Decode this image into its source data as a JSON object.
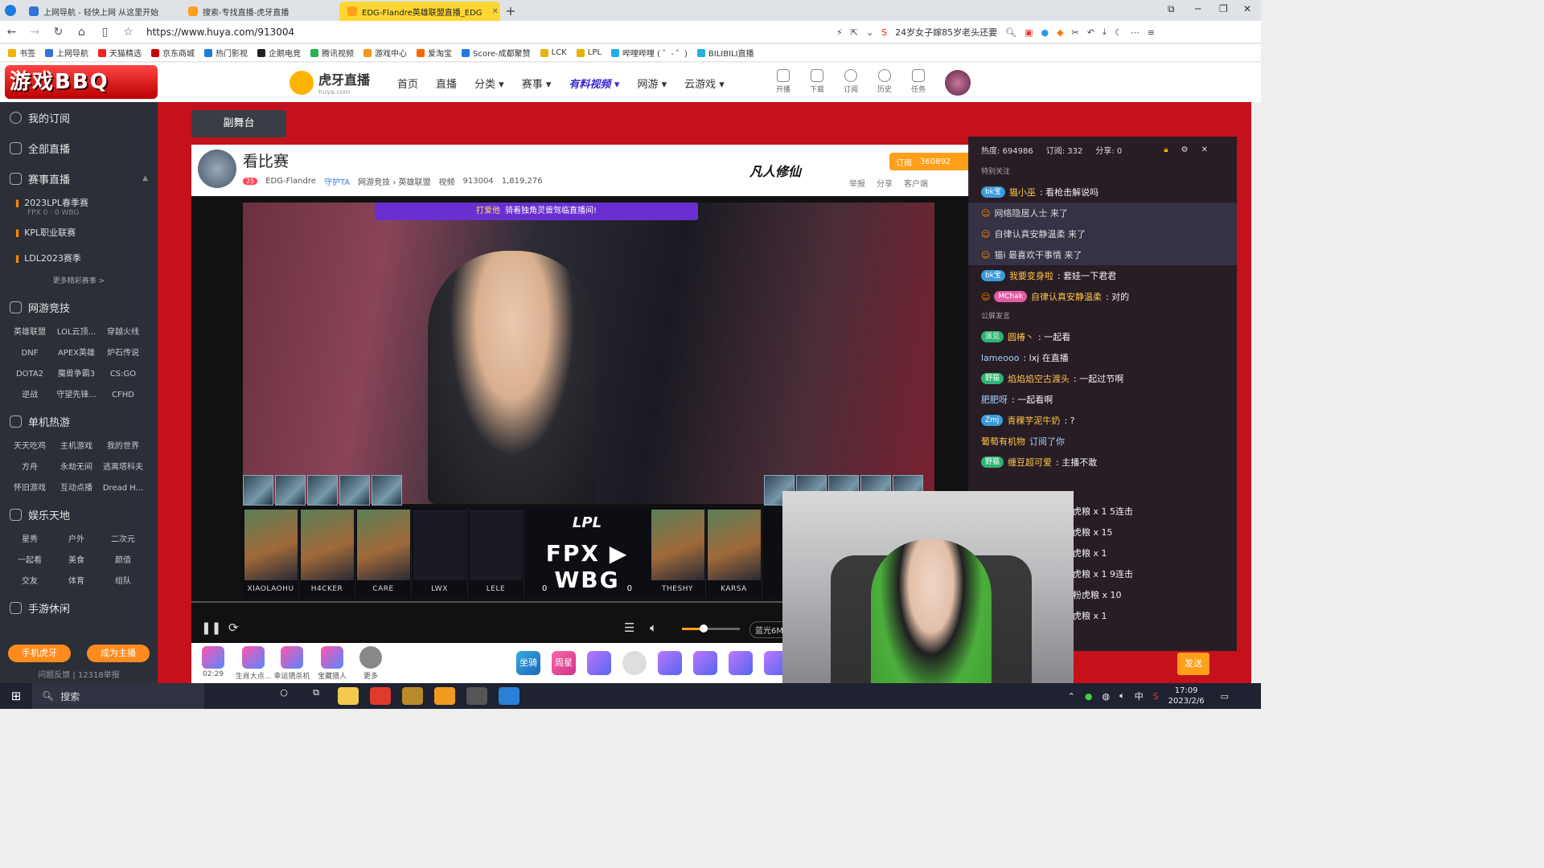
{
  "browser": {
    "tabs": [
      {
        "title": "上网导航 - 轻快上网 从这里开始",
        "color": "#2f74d6",
        "active": false
      },
      {
        "title": "搜索-专找直播-虎牙直播",
        "color": "#ff9f1a",
        "active": false
      },
      {
        "title": "EDG-Flandre英雄联盟直播_EDG",
        "color": "#ff9f1a",
        "active": true
      }
    ],
    "new_tab": "+",
    "url": "https://www.huya.com/913004",
    "search_hint": "24岁女子嫁85岁老头还要",
    "bookmarks": [
      "书签",
      "上网导航",
      "天猫精选",
      "京东商城",
      "热门影视",
      "企鹅电竞",
      "腾讯视频",
      "游戏中心",
      "爱淘宝",
      "Score-成都聚赞",
      "LCK",
      "LPL",
      "哔哩哔哩 ( ゜- ゜)",
      "BILIBILI直播"
    ]
  },
  "site": {
    "logo_text": "游戏BBQ",
    "huya_name": "虎牙直播",
    "huya_sub": "huya.com",
    "nav": [
      "首页",
      "直播",
      "分类 ▾",
      "赛事 ▾",
      "有料视频 ▾",
      "网游 ▾",
      "云游戏 ▾"
    ],
    "tools": [
      "开播",
      "下载",
      "订阅",
      "历史",
      "任务"
    ]
  },
  "sidebar": {
    "main": [
      "我的订阅",
      "全部直播",
      "赛事直播"
    ],
    "events": [
      {
        "title": "2023LPL春季赛",
        "score": "FPX 0 · 0 WBG"
      },
      {
        "title": "KPL职业联赛",
        "score": ""
      },
      {
        "title": "LDL2023赛季",
        "score": ""
      }
    ],
    "more": "更多精彩赛事 >",
    "sections": [
      {
        "name": "网游竞技",
        "items": [
          "英雄联盟",
          "LOL云顶...",
          "穿越火线",
          "DNF",
          "APEX英雄",
          "炉石传说",
          "DOTA2",
          "魔兽争霸3",
          "CS:GO",
          "逆战",
          "守望先锋...",
          "CFHD"
        ]
      },
      {
        "name": "单机热游",
        "items": [
          "天天吃鸡",
          "主机游戏",
          "我的世界",
          "方舟",
          "永劫无间",
          "逃离塔科夫",
          "怀旧游戏",
          "互动点播",
          "Dread H..."
        ]
      },
      {
        "name": "娱乐天地",
        "items": [
          "星秀",
          "户外",
          "二次元",
          "一起看",
          "美食",
          "颜值",
          "交友",
          "体育",
          "组队"
        ]
      },
      {
        "name": "手游休闲",
        "items": []
      }
    ],
    "btn_phone": "手机虎牙",
    "btn_anchor": "成为主播",
    "footer": "问题反馈 | 12318举报"
  },
  "room": {
    "stage": "副舞台",
    "title": "看比赛",
    "level": "25",
    "streamer": "EDG-Flandre",
    "guard": "守护TA",
    "category": "网游竞技 › 英雄联盟",
    "video": "视频",
    "room_id": "913004",
    "viewers": "1,819,276",
    "logo": "凡人修仙",
    "report": "举报",
    "share": "分享",
    "client": "客户端",
    "subscribe": "订阅",
    "subscribe_count": "360892"
  },
  "video": {
    "promo_highlight": "打爱他",
    "promo_text": "骑着独角灵兽驾临直播间!",
    "event": "LPL",
    "team1": "FPX",
    "team2": "WBG",
    "score1": "0",
    "score2": "0",
    "players_left": [
      "XIAOLAOHU",
      "H4CKER",
      "CARE",
      "LWX",
      "LELE"
    ],
    "players_right": [
      "THESHY",
      "KARSA"
    ],
    "volume": 0.38,
    "quality": "蓝光6M"
  },
  "gifts": {
    "time": "02:29",
    "items": [
      "生肖大点...",
      "幸运猎杀机",
      "宝藏猎人",
      "更多"
    ],
    "right": [
      "坐骑",
      "周星"
    ]
  },
  "chat": {
    "heat_label": "热度: 694986",
    "sub_label": "订阅: 332",
    "share_label": "分享: 0",
    "special": "特别关注",
    "public": "公屏发言",
    "special_msgs": [
      {
        "badge": "bk宝",
        "nick": "猫小巫",
        "text": ": 看枪击解说吗",
        "color": "#3a9bdc"
      },
      {
        "badge": "",
        "nick": "",
        "text": "网络隐居人士 来了",
        "color": ""
      },
      {
        "badge": "",
        "nick": "",
        "text": "自律认真安静温柔 来了",
        "color": ""
      },
      {
        "badge": "",
        "nick": "",
        "text": "猫i 最喜欢干事情 来了",
        "color": ""
      },
      {
        "badge": "bk宝",
        "nick": "我要变身啦",
        "text": ": 套娃一下君君",
        "color": "#3a9bdc"
      },
      {
        "badge": "MChak",
        "nick": "自律认真安静温柔",
        "text": ": 对的",
        "color": "#e05ca4"
      }
    ],
    "public_msgs": [
      {
        "badge": "派见",
        "nick": "圆椿丶",
        "text": ": 一起看",
        "color": "#2fb374"
      },
      {
        "badge": "",
        "nick": "lameooo",
        "text": ": lxj 在直播",
        "color": ""
      },
      {
        "badge": "野猫",
        "nick": "焰焰焰空古渡头",
        "text": ": 一起过节啊",
        "color": "#2fb374"
      },
      {
        "badge": "",
        "nick": "肥肥呀",
        "text": ": 一起看啊",
        "color": ""
      },
      {
        "badge": "Zmj",
        "nick": "青稞芋泥牛奶",
        "text": ": ?",
        "color": "#3a9bdc"
      },
      {
        "badge": "",
        "nick": "葡萄有机物",
        "text": " 订阅了你",
        "color": ""
      },
      {
        "badge": "野猫",
        "nick": "缠豆超可爱",
        "text": ": 主播不敢",
        "color": "#2fb374"
      }
    ],
    "gift_lines": [
      "虎粮 x 1 5连击",
      "虎粮 x 15",
      "虎粮 x 1",
      "虎粮 x 1 9连击",
      "粉虎粮 x 10",
      "虎粮 x 1"
    ],
    "send": "发送"
  },
  "taskbar": {
    "search": "搜索",
    "ime": "中",
    "time": "17:09",
    "date": "2023/2/6"
  }
}
